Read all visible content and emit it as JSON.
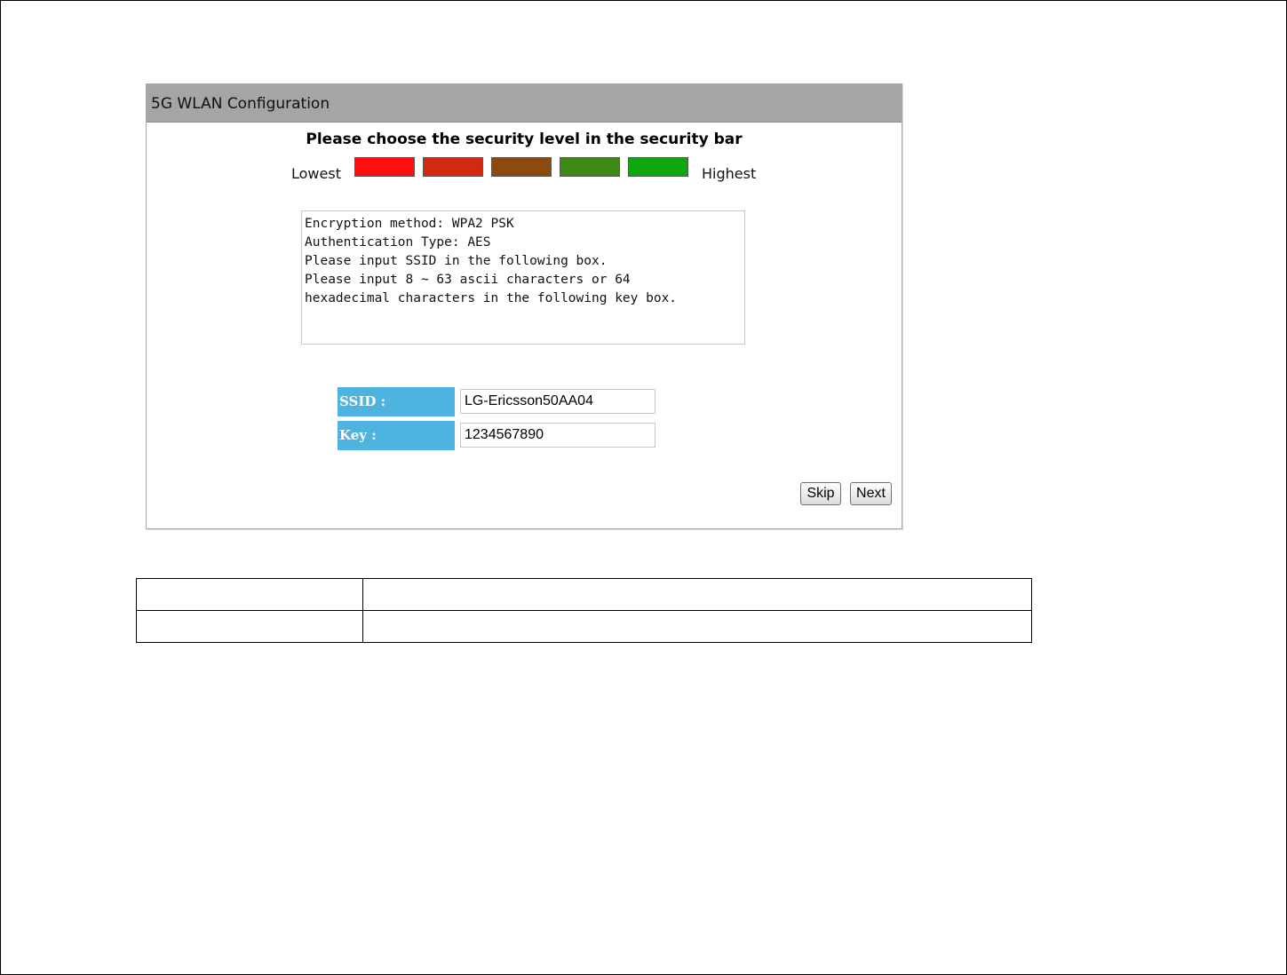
{
  "panel": {
    "title": "5G WLAN Configuration",
    "heading": "Please choose the security level in the security bar",
    "security_bar": {
      "lowest_label": "Lowest",
      "highest_label": "Highest",
      "levels": [
        {
          "name": "level-1",
          "color": "#ff1010"
        },
        {
          "name": "level-2",
          "color": "#d22a10"
        },
        {
          "name": "level-3",
          "color": "#8a4a10"
        },
        {
          "name": "level-4",
          "color": "#3f8a16"
        },
        {
          "name": "level-5",
          "color": "#0ea80e"
        }
      ]
    },
    "info_lines": [
      "Encryption method: WPA2 PSK",
      "Authentication Type: AES",
      "Please input SSID in the following box.",
      "Please input 8 ~ 63 ascii characters or 64",
      "hexadecimal characters in the following key box."
    ],
    "fields": {
      "ssid_label": "SSID :",
      "ssid_value": "LG-Ericsson50AA04",
      "key_label": "Key :",
      "key_value": "1234567890"
    },
    "buttons": {
      "skip": "Skip",
      "next": "Next"
    }
  },
  "table": {
    "rows": [
      [
        "",
        ""
      ],
      [
        "",
        ""
      ]
    ]
  }
}
